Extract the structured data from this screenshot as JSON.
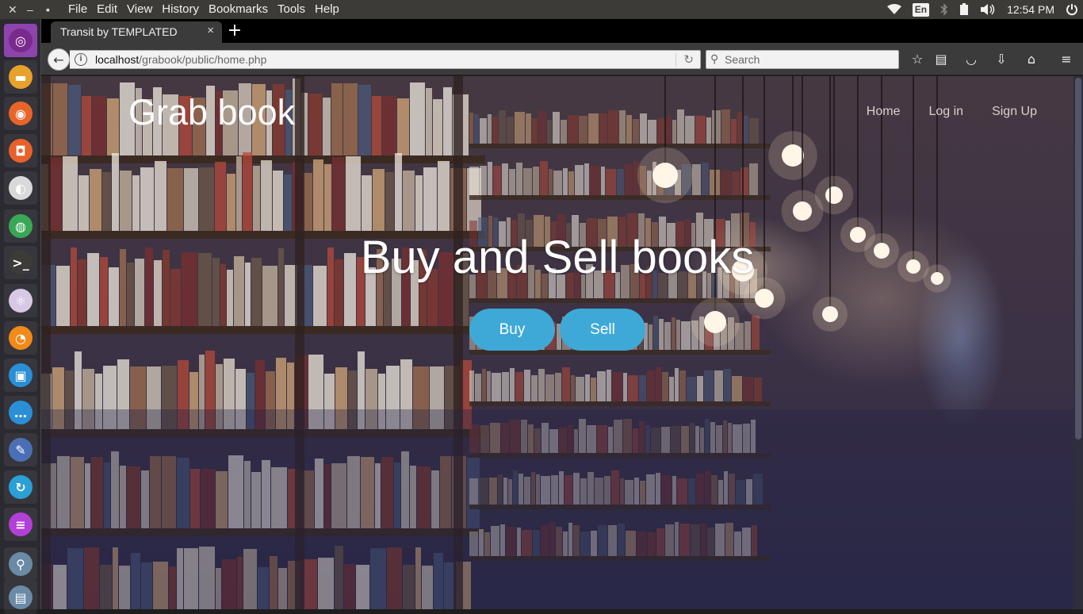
{
  "system_panel": {
    "window_close": "✕",
    "window_minimize": "–",
    "window_restore": "▪",
    "menus": [
      "File",
      "Edit",
      "View",
      "History",
      "Bookmarks",
      "Tools",
      "Help"
    ],
    "keyboard_layout": "En",
    "clock": "12:54 PM"
  },
  "launcher": {
    "items": [
      {
        "icon": "ubuntu-dash-icon",
        "glyph": "◎",
        "color": "#7a2a8c"
      },
      {
        "icon": "files-icon",
        "glyph": "▬",
        "color": "#e8a12a"
      },
      {
        "icon": "firefox-icon",
        "glyph": "◉",
        "color": "#e8652a"
      },
      {
        "icon": "software-center-icon",
        "glyph": "◘",
        "color": "#e8602a"
      },
      {
        "icon": "settings-icon",
        "glyph": "◐",
        "color": "#d9d9d9"
      },
      {
        "icon": "chrome-icon",
        "glyph": "◍",
        "color": "#3aa757"
      },
      {
        "icon": "terminal-icon",
        "glyph": ">_",
        "color": "#3c3b37"
      },
      {
        "icon": "atom-icon",
        "glyph": "⚛",
        "color": "#d7c8e6"
      },
      {
        "icon": "orange-app-icon",
        "glyph": "◔",
        "color": "#f08a1a"
      },
      {
        "icon": "screenshot-icon",
        "glyph": "▣",
        "color": "#2a8fd6"
      },
      {
        "icon": "messaging-icon",
        "glyph": "…",
        "color": "#2a8fd6"
      },
      {
        "icon": "pen-tool-icon",
        "glyph": "✎",
        "color": "#4a6fb5"
      },
      {
        "icon": "update-icon",
        "glyph": "↻",
        "color": "#2aa0d6"
      },
      {
        "icon": "text-editor-icon",
        "glyph": "≡",
        "color": "#b23fd6"
      },
      {
        "icon": "search-tool-icon",
        "glyph": "⚲",
        "color": "#6a8aa5"
      },
      {
        "icon": "archive-icon",
        "glyph": "▤",
        "color": "#6a8aa5"
      }
    ]
  },
  "browser": {
    "tab_title": "Transit by TEMPLATED",
    "tab_close": "×",
    "new_tab": "+",
    "back": "←",
    "url_host": "localhost",
    "url_path": "/grabook/public/home.php",
    "reload": "↻",
    "search_placeholder": "Search",
    "toolbar_icons": [
      {
        "name": "bookmark-star-icon",
        "glyph": "☆"
      },
      {
        "name": "reader-list-icon",
        "glyph": "▤"
      },
      {
        "name": "pocket-icon",
        "glyph": "◡"
      },
      {
        "name": "downloads-icon",
        "glyph": "⇩"
      },
      {
        "name": "home-icon",
        "glyph": "⌂"
      },
      {
        "name": "menu-icon",
        "glyph": "≡"
      }
    ]
  },
  "site": {
    "brand": "Grab book",
    "nav": [
      "Home",
      "Log in",
      "Sign Up"
    ],
    "hero_title": "Buy and Sell books",
    "buy_label": "Buy",
    "sell_label": "Sell",
    "accent_color": "#3ea9d7"
  }
}
